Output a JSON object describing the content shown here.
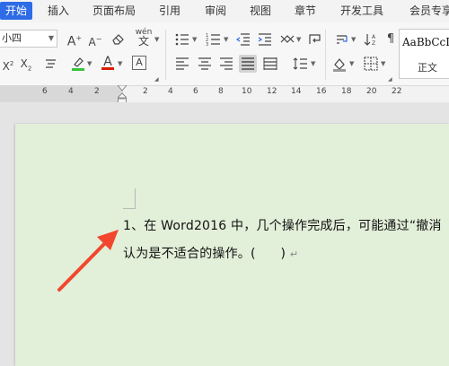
{
  "ribbon": {
    "tabs": [
      {
        "label": "开始",
        "active": true
      },
      {
        "label": "插入"
      },
      {
        "label": "页面布局"
      },
      {
        "label": "引用"
      },
      {
        "label": "审阅"
      },
      {
        "label": "视图"
      },
      {
        "label": "章节"
      },
      {
        "label": "开发工具"
      },
      {
        "label": "会员专享"
      }
    ]
  },
  "toolbar": {
    "font_size_value": "小四",
    "style_gallery": {
      "sample_text": "AaBbCcDd",
      "style_name": "正文"
    },
    "phonetic_guide_label": "wén",
    "font_color_label": "A",
    "highlight_label": "A",
    "accent_color": "#2e6be6",
    "font_color": "#d81e06",
    "highlight_color": "#3ac43a"
  },
  "ruler": {
    "numbers_left": [
      "6",
      "4",
      "2"
    ],
    "numbers_right": [
      "2",
      "4",
      "6",
      "8",
      "10",
      "12",
      "14",
      "16",
      "18",
      "20",
      "22"
    ]
  },
  "document": {
    "line1": "1、在 Word2016 中，几个操作完成后，可能通过“撤消",
    "line2": "认为是不适合的操作。(      )",
    "paragraph_mark": "↵",
    "page_color": "#e2efd9"
  },
  "annotation": {
    "arrow_color": "#f2462e"
  }
}
